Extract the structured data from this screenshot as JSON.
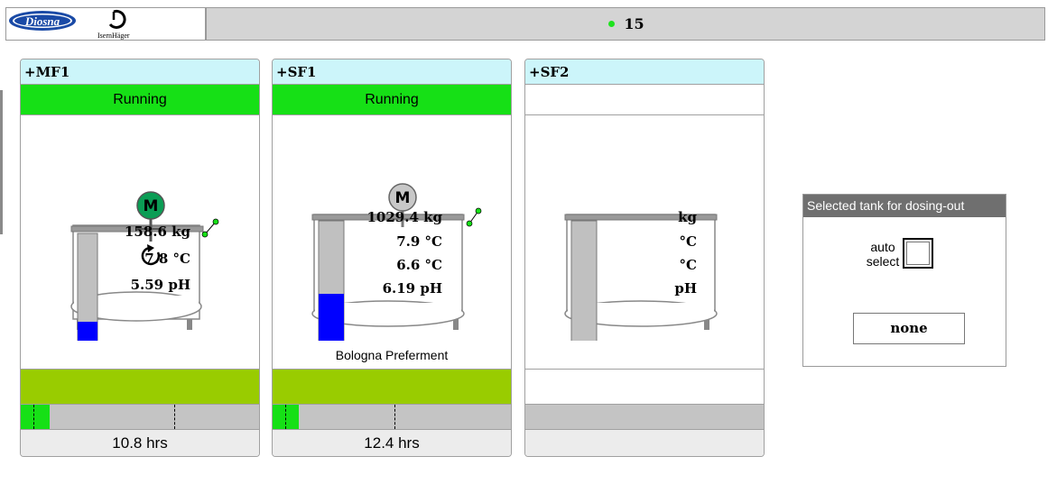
{
  "header": {
    "brand_logo": "Diosna",
    "partner_logo": "IsernHäger",
    "status_count": "15",
    "status_color": "#1ee31e"
  },
  "colors": {
    "running": "#16e016",
    "level": "#0000ff",
    "motor_running": "#0b9d55",
    "motor_idle": "#c8c8c8",
    "olive": "#99cc00",
    "title_bg": "#ccf5fa"
  },
  "tanks": [
    {
      "name": "+MF1",
      "state": "Running",
      "motor_label": "M",
      "motor_running": true,
      "agitator_icon": "rotate-icon",
      "level_fraction": 0.31,
      "weight": "158.6 kg",
      "temp1": "7.8 °C",
      "temp2": "",
      "ph": "5.59 pH",
      "product": "",
      "progress_fraction": 0.12,
      "hours": "10.8 hrs"
    },
    {
      "name": "+SF1",
      "state": "Running",
      "motor_label": "M",
      "motor_running": false,
      "agitator_icon": "",
      "level_fraction": 0.5,
      "weight": "1029.4 kg",
      "temp1": "7.9 °C",
      "temp2": "6.6 °C",
      "ph": "6.19 pH",
      "product": "Bologna Preferment",
      "progress_fraction": 0.11,
      "hours": "12.4 hrs"
    },
    {
      "name": "+SF2",
      "state": "",
      "motor_label": "",
      "motor_running": false,
      "agitator_icon": "",
      "level_fraction": 0,
      "weight": "kg",
      "temp1": "°C",
      "temp2": "°C",
      "ph": "pH",
      "product": "",
      "progress_fraction": 0,
      "hours": ""
    }
  ],
  "dosing": {
    "title": "Selected tank for dosing-out",
    "auto_select_label": "auto select",
    "auto_select_checked": false,
    "selected": "none"
  }
}
